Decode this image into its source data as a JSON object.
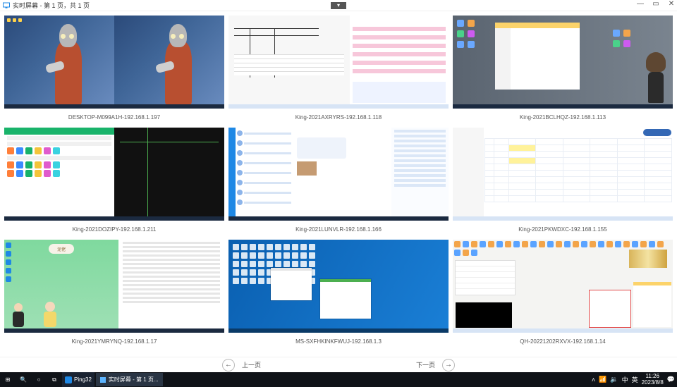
{
  "titlebar": {
    "appTitle": "实时屏幕 - 第 1 页，共 1 页",
    "minimize": "—",
    "maximize": "▭",
    "close": "✕",
    "dropdown": "▾"
  },
  "clients": [
    {
      "label": "DESKTOP-M099A1H-192.168.1.197"
    },
    {
      "label": "King-2021AXRYRS-192.168.1.118"
    },
    {
      "label": "King-2021BCLHQZ-192.168.1.113"
    },
    {
      "label": "King-2021DOZIPY-192.168.1.211"
    },
    {
      "label": "King-2021LUNVLR-192.168.1.166"
    },
    {
      "label": "King-2021PKWDXC-192.168.1.155"
    },
    {
      "label": "King-2021YMRYNQ-192.168.1.17"
    },
    {
      "label": "MS-SXFHKINKFWUJ-192.168.1.3"
    },
    {
      "label": "QH-20221202RXVX-192.168.1.14"
    }
  ],
  "thumb7": {
    "badge": "泥佬"
  },
  "pager": {
    "prev": "上一页",
    "next": "下一页",
    "prevGlyph": "←",
    "nextGlyph": "→"
  },
  "taskbar": {
    "start": "⊞",
    "search": "🔍",
    "cortana": "○",
    "taskview": "⧉",
    "app1": "Ping32",
    "app2": "实时屏幕 - 第 1 页...",
    "tray": {
      "up": "˄",
      "net": "📶",
      "sound": "🔉",
      "ime1": "中",
      "ime2": "英",
      "time": "11:26",
      "date": "2023/8/8",
      "notif": "💬"
    }
  }
}
